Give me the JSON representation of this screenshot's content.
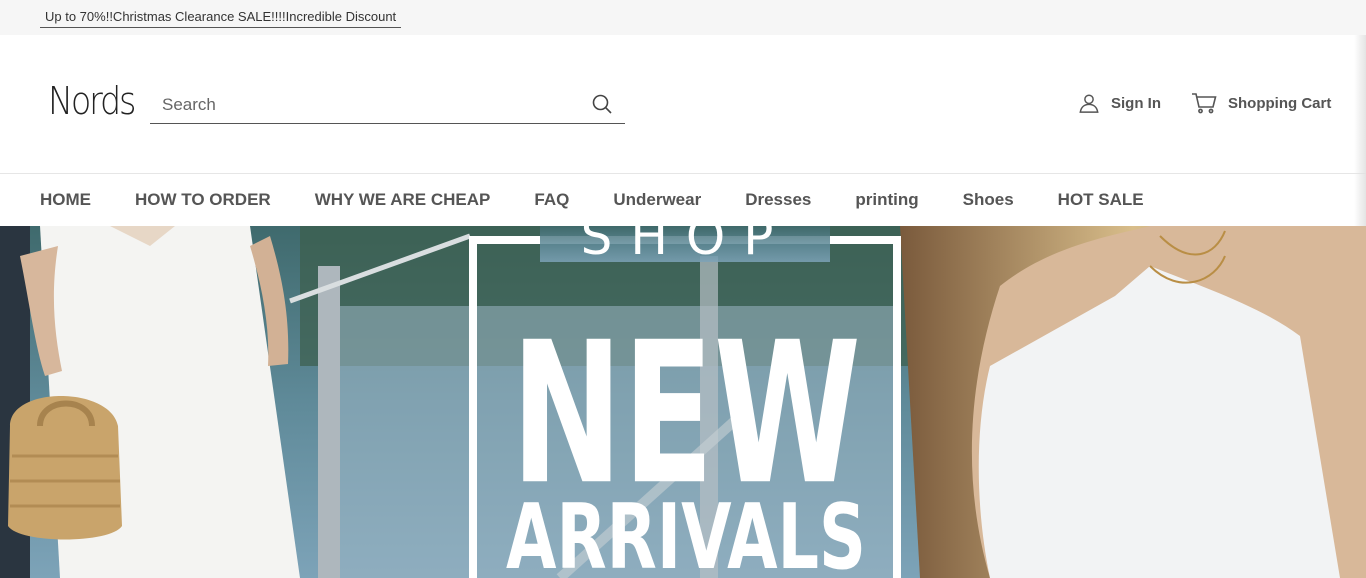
{
  "promo": {
    "text": "Up to 70%!!Christmas Clearance SALE!!!!Incredible Discount"
  },
  "header": {
    "logo": "Nords",
    "search_placeholder": "Search",
    "sign_in": "Sign In",
    "cart": "Shopping Cart"
  },
  "nav": {
    "items": [
      "HOME",
      "HOW TO ORDER",
      "WHY WE ARE CHEAP",
      "FAQ",
      "Underwear",
      "Dresses",
      "printing",
      "Shoes",
      "HOT SALE"
    ]
  },
  "banner": {
    "line1": "SHOP",
    "line2": "NEW",
    "line3": "ARRIVALS"
  },
  "colors": {
    "text": "#555555",
    "promo_bg": "#f6f6f6",
    "banner_text": "#ffffff"
  }
}
